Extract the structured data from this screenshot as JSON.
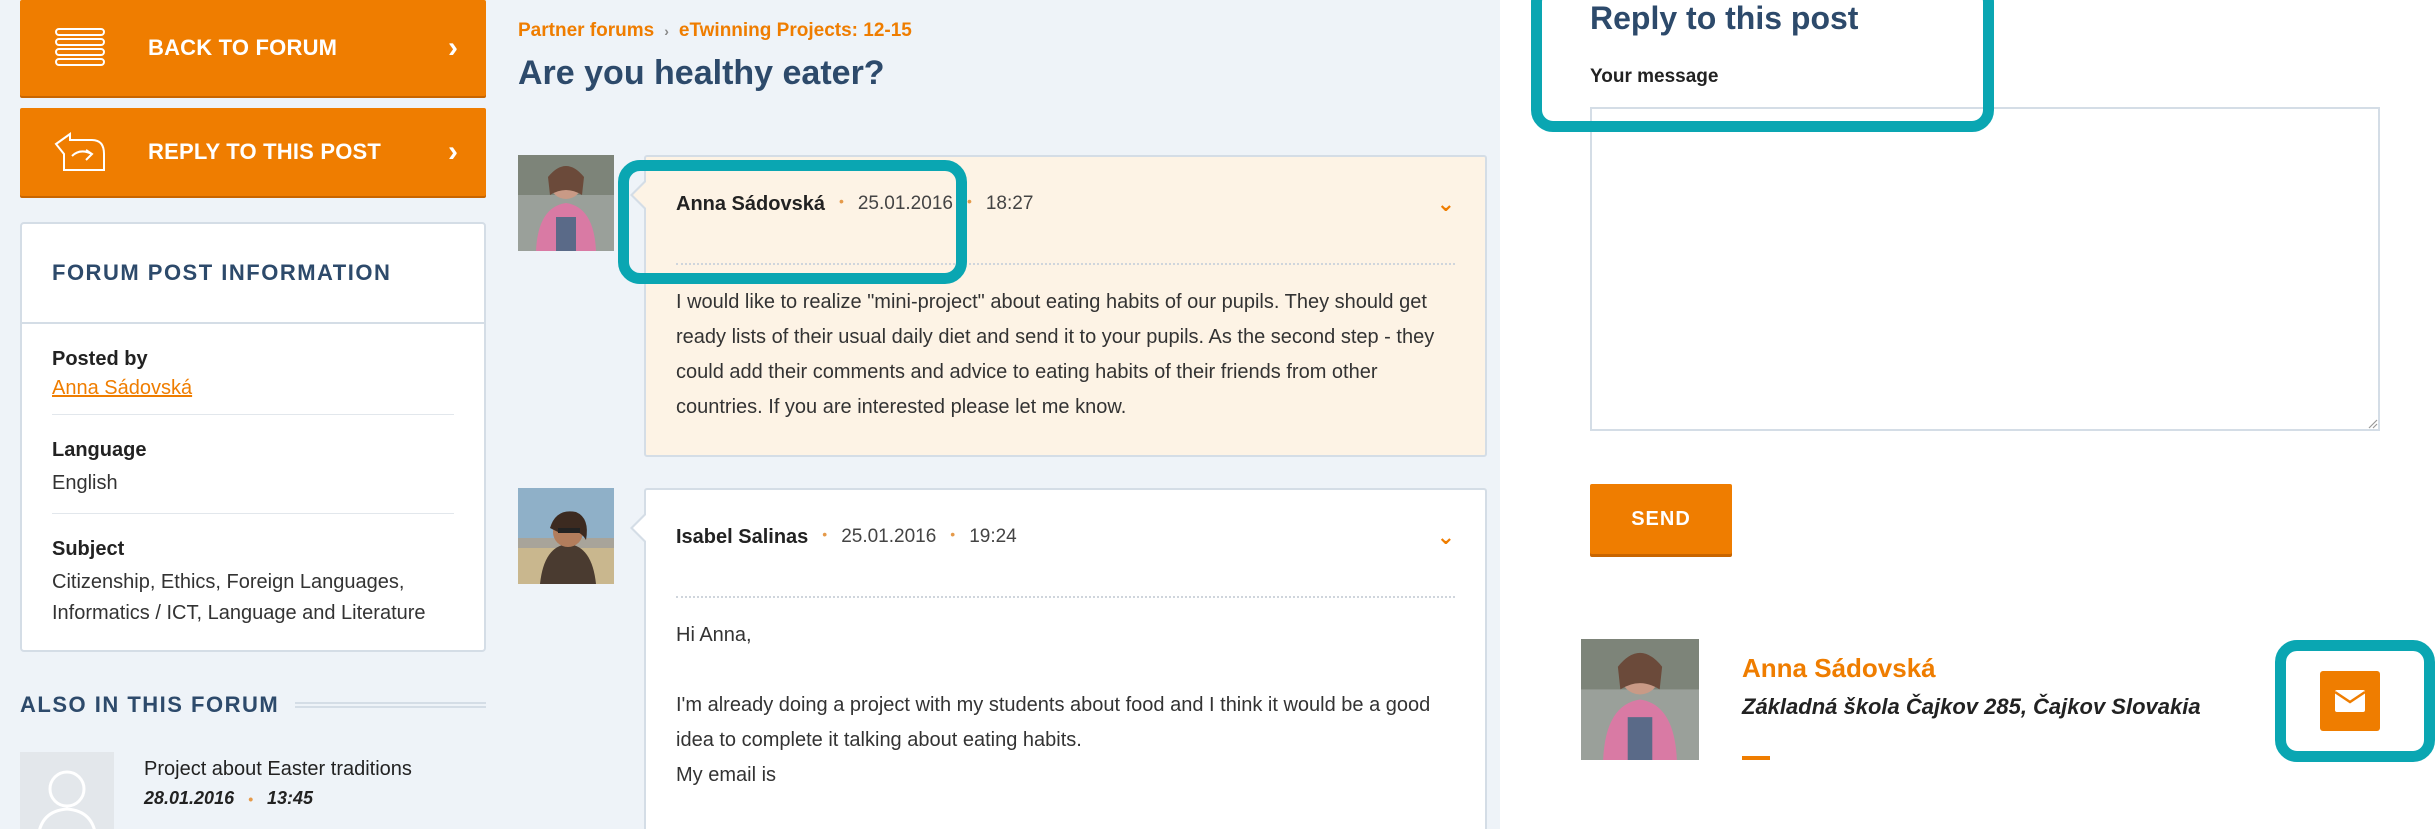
{
  "sidebar": {
    "back_label": "BACK TO FORUM",
    "reply_label": "REPLY TO THIS POST",
    "info_title": "FORUM POST INFORMATION",
    "posted_by_label": "Posted by",
    "posted_by_value": "Anna Sádovská",
    "language_label": "Language",
    "language_value": "English",
    "subject_label": "Subject",
    "subject_value": "Citizenship, Ethics, Foreign Languages, Informatics / ICT, Language and Literature",
    "also_title": "ALSO IN THIS FORUM",
    "also_items": [
      {
        "title": "Project about Easter traditions",
        "date": "28.01.2016",
        "time": "13:45"
      }
    ]
  },
  "breadcrumb": [
    "Partner forums",
    "eTwinning Projects: 12-15"
  ],
  "page_title": "Are you healthy eater?",
  "posts": [
    {
      "author": "Anna Sádovská",
      "date": "25.01.2016",
      "time": "18:27",
      "body": [
        "I would like to realize \"mini-project\" about eating habits of our pupils. They should get ready lists of their usual daily diet and send it to your pupils. As the second step - they could add their comments and advice to eating habits of their friends from other countries. If you are interested please let me know."
      ]
    },
    {
      "author": "Isabel Salinas",
      "date": "25.01.2016",
      "time": "19:24",
      "body": [
        "Hi Anna,",
        "I'm already doing a project with my students about food and I think it would be a good idea to complete it talking about eating habits.",
        "My email is"
      ]
    }
  ],
  "reply": {
    "title": "Reply to this post",
    "message_label": "Your message",
    "message_value": "",
    "send_label": "SEND"
  },
  "author_card": {
    "name": "Anna Sádovská",
    "school": "Základná škola Čajkov 285, Čajkov Slovakia"
  },
  "icons": {
    "back": "list-lines-icon",
    "reply": "reply-arrow-icon",
    "chevron": "chevron-right-icon",
    "post_toggle": "chevron-down-icon",
    "mail": "envelope-icon",
    "placeholder_avatar": "user-silhouette-icon"
  },
  "colors": {
    "accent": "#ef7d00",
    "heading": "#2d4a6b",
    "highlight": "#0aa6b2",
    "sidebar_bg": "#eef3f8",
    "post_highlight_bg": "#fdf3e5"
  }
}
